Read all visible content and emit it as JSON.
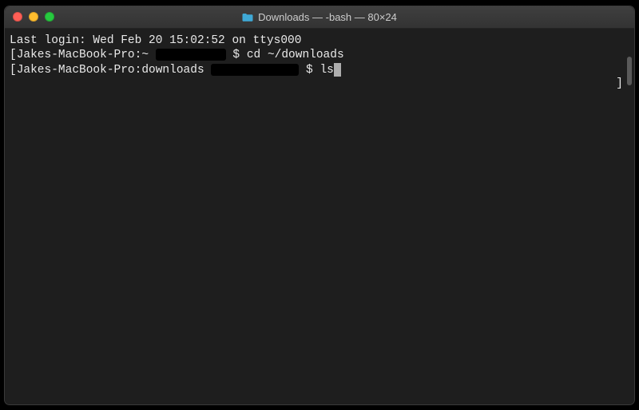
{
  "titlebar": {
    "title": "Downloads — -bash — 80×24",
    "folder_icon": "folder-icon"
  },
  "traffic_lights": {
    "close": "close",
    "minimize": "minimize",
    "maximize": "maximize"
  },
  "terminal": {
    "last_login_line": "Last login: Wed Feb 20 15:02:52 on ttys000",
    "line2_prompt_left": "[Jakes-MacBook-Pro:~ ",
    "line2_dollar": " $ ",
    "line2_command": "cd ~/downloads",
    "line3_prompt_left": "[Jakes-MacBook-Pro:downloads ",
    "line3_dollar": " $ ",
    "line3_command": "ls",
    "right_bracket": "]"
  }
}
